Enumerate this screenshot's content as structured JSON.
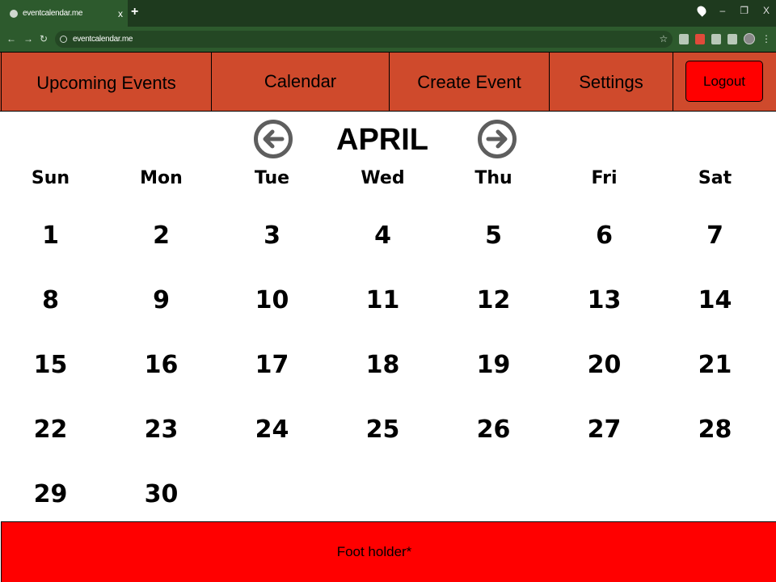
{
  "browser": {
    "tab_title": "eventcalendar.me",
    "tab_close": "x",
    "new_tab": "+",
    "url": "eventcalendar.me",
    "win_minimize": "–",
    "win_restore": "❐",
    "win_close": "X"
  },
  "nav": {
    "upcoming": "Upcoming Events",
    "calendar": "Calendar",
    "create": "Create Event",
    "settings": "Settings",
    "logout": "Logout"
  },
  "calendar": {
    "month": "APRIL",
    "weekdays": [
      "Sun",
      "Mon",
      "Tue",
      "Wed",
      "Thu",
      "Fri",
      "Sat"
    ],
    "first_weekday_index": 0,
    "days": [
      "1",
      "2",
      "3",
      "4",
      "5",
      "6",
      "7",
      "8",
      "9",
      "10",
      "11",
      "12",
      "13",
      "14",
      "15",
      "16",
      "17",
      "18",
      "19",
      "20",
      "21",
      "22",
      "23",
      "24",
      "25",
      "26",
      "27",
      "28",
      "29",
      "30"
    ]
  },
  "footer": {
    "text": "Foot holder*"
  },
  "colors": {
    "nav_bg": "#cf4a2c",
    "logout_bg": "#ff0000",
    "footer_bg": "#ff0000",
    "arrow_gray": "#5e5e5e"
  }
}
